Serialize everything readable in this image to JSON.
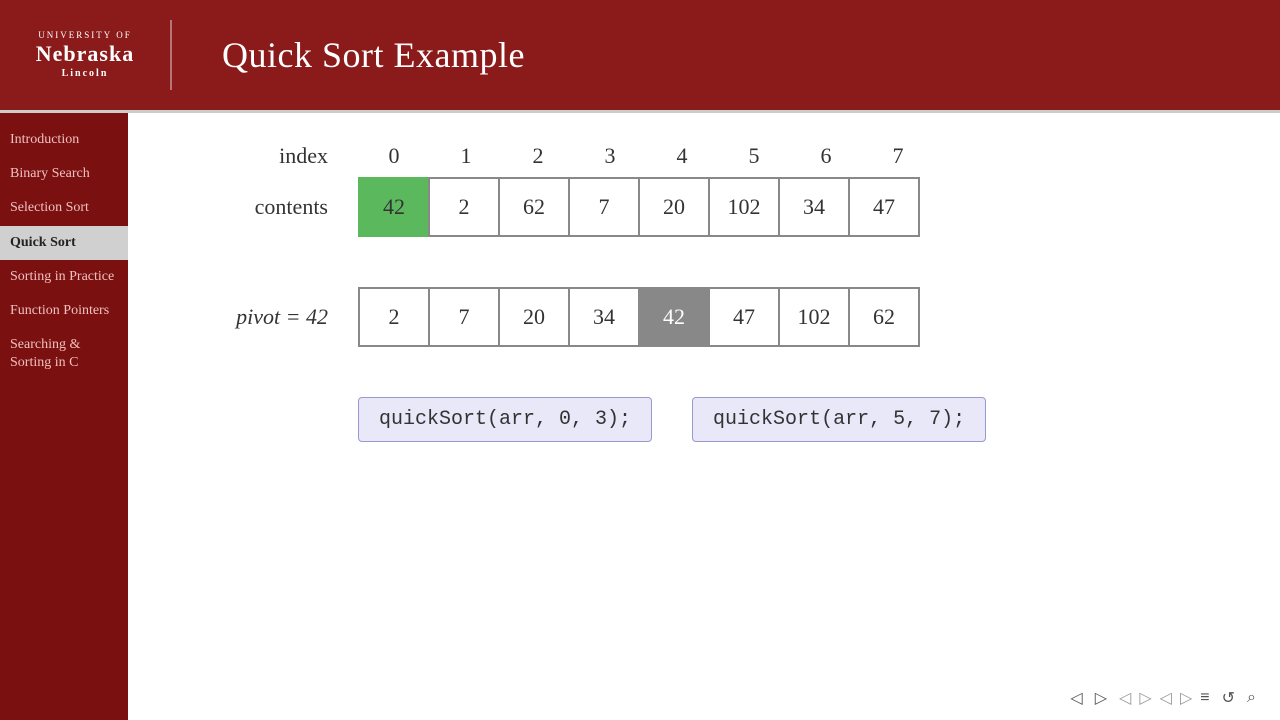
{
  "header": {
    "title": "Quick Sort Example",
    "university_line1": "UNIVERSITY OF",
    "university_nebraska": "Nebraska",
    "university_lincoln": "Lincoln"
  },
  "sidebar": {
    "items": [
      {
        "id": "introduction",
        "label": "Introduction",
        "active": false
      },
      {
        "id": "binary-search",
        "label": "Binary Search",
        "active": false
      },
      {
        "id": "selection-sort",
        "label": "Selection Sort",
        "active": false
      },
      {
        "id": "quick-sort",
        "label": "Quick Sort",
        "active": true
      },
      {
        "id": "sorting-practice",
        "label": "Sorting in Practice",
        "active": false
      },
      {
        "id": "function-pointers",
        "label": "Function Pointers",
        "active": false
      },
      {
        "id": "searching-sorting-c",
        "label": "Searching & Sorting in C",
        "active": false
      }
    ]
  },
  "main": {
    "index_label": "index",
    "contents_label": "contents",
    "indices": [
      "0",
      "1",
      "2",
      "3",
      "4",
      "5",
      "6",
      "7"
    ],
    "original_array": [
      {
        "value": "42",
        "style": "green"
      },
      {
        "value": "2",
        "style": "normal"
      },
      {
        "value": "62",
        "style": "normal"
      },
      {
        "value": "7",
        "style": "normal"
      },
      {
        "value": "20",
        "style": "normal"
      },
      {
        "value": "102",
        "style": "normal"
      },
      {
        "value": "34",
        "style": "normal"
      },
      {
        "value": "47",
        "style": "normal"
      }
    ],
    "pivot_label": "pivot = 42",
    "sorted_array": [
      {
        "value": "2",
        "style": "normal"
      },
      {
        "value": "7",
        "style": "normal"
      },
      {
        "value": "20",
        "style": "normal"
      },
      {
        "value": "34",
        "style": "normal"
      },
      {
        "value": "42",
        "style": "gray"
      },
      {
        "value": "47",
        "style": "normal"
      },
      {
        "value": "102",
        "style": "normal"
      },
      {
        "value": "62",
        "style": "normal"
      }
    ],
    "code_left": "quickSort(arr, 0, 3);",
    "code_right": "quickSort(arr, 5, 7);"
  },
  "footer": {
    "nav_icons": [
      "◁",
      "▷",
      "◁",
      "▷",
      "◁",
      "▷",
      "≡",
      "↺",
      "⌕"
    ]
  }
}
